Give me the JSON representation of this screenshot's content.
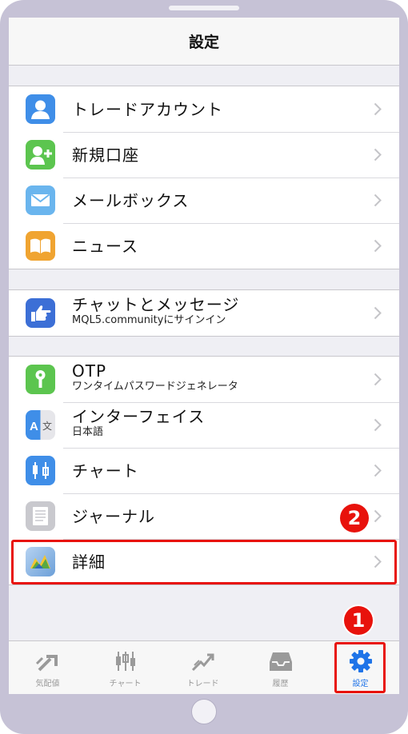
{
  "header": {
    "title": "設定"
  },
  "groups": [
    {
      "items": [
        {
          "label": "トレードアカウント",
          "icon": "user-icon",
          "color": "#3f8ee8"
        },
        {
          "label": "新規口座",
          "icon": "add-user-icon",
          "color": "#5cc54f"
        },
        {
          "label": "メールボックス",
          "icon": "mail-icon",
          "color": "#6ab5ee"
        },
        {
          "label": "ニュース",
          "icon": "book-icon",
          "color": "#f0a431"
        }
      ]
    },
    {
      "items": [
        {
          "label": "チャットとメッセージ",
          "sublabel": "MQL5.communityにサインイン",
          "icon": "pointing-hand-icon",
          "color": "#3c6fd6"
        }
      ]
    },
    {
      "items": [
        {
          "label": "OTP",
          "sublabel": "ワンタイムパスワードジェネレータ",
          "icon": "key-icon",
          "color": "#5cc54f"
        },
        {
          "label": "インターフェイス",
          "sublabel": "日本語",
          "icon": "translate-icon",
          "color": "#3f8ee8"
        },
        {
          "label": "チャート",
          "icon": "candlestick-icon",
          "color": "#3f8ee8"
        },
        {
          "label": "ジャーナル",
          "icon": "journal-icon",
          "color": "#c9c9ce"
        },
        {
          "label": "詳細",
          "icon": "metatrader-logo-icon",
          "color": "#8bb7e8"
        }
      ]
    }
  ],
  "callouts": [
    "2",
    "1"
  ],
  "highlight_color": "#e8120c",
  "tabbar": {
    "tabs": [
      {
        "label": "気配値",
        "icon": "quotes-icon",
        "active": false
      },
      {
        "label": "チャート",
        "icon": "chart-icon",
        "active": false
      },
      {
        "label": "トレード",
        "icon": "trade-icon",
        "active": false
      },
      {
        "label": "履歴",
        "icon": "history-icon",
        "active": false
      },
      {
        "label": "設定",
        "icon": "gear-icon",
        "active": true
      }
    ],
    "active_color": "#1f74e8",
    "inactive_color": "#9a9a9a"
  }
}
